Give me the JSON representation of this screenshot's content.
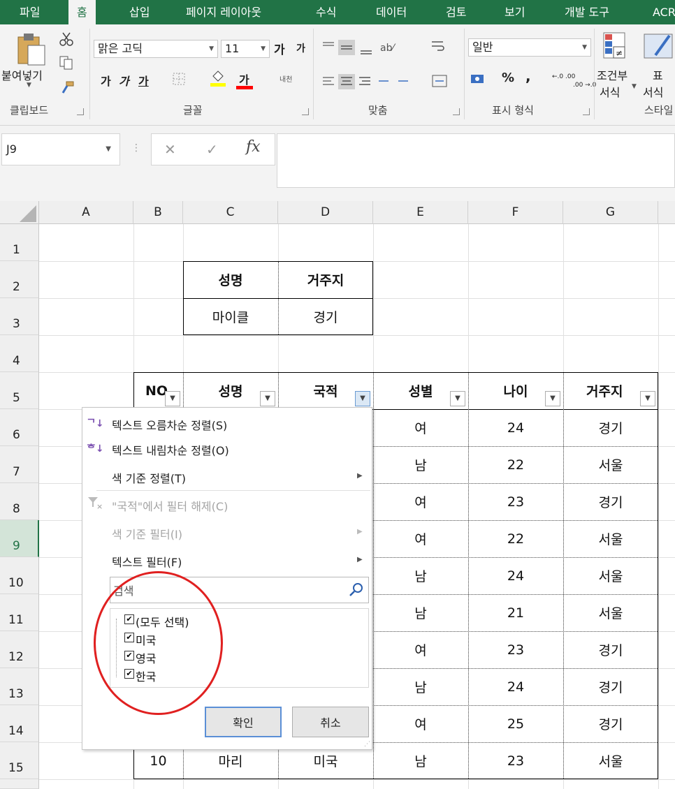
{
  "ribbon_tabs": [
    "파일",
    "홈",
    "삽입",
    "페이지 레이아웃",
    "수식",
    "데이터",
    "검토",
    "보기",
    "개발 도구",
    "ACR"
  ],
  "active_tab": "홈",
  "clipboard": {
    "paste_label": "붙여넣기",
    "group_label": "클립보드"
  },
  "font": {
    "name": "맑은 고딕",
    "size": "11",
    "grow": "가",
    "shrink": "가",
    "bold": "가",
    "italic": "가",
    "underline": "가",
    "font_color": "가",
    "phonetic": "내천",
    "group_label": "글꼴",
    "highlight_color": "#ffff00",
    "font_color_bar": "#ff0000"
  },
  "alignment": {
    "group_label": "맞춤"
  },
  "number": {
    "format": "일반",
    "percent": "%",
    "comma": ",",
    "inc_decimal": "←.0 .00",
    "dec_decimal": ".00 →.0",
    "group_label": "표시 형식"
  },
  "styles": {
    "conditional_line1": "조건부",
    "conditional_line2": "서식",
    "table_line1": "표",
    "table_line2": "서식",
    "group_label": "스타일"
  },
  "formula_bar": {
    "name_box": "J9",
    "cancel": "✕",
    "enter": "✓",
    "fx": "fx",
    "content": ""
  },
  "columns": [
    "A",
    "B",
    "C",
    "D",
    "E",
    "F",
    "G"
  ],
  "rows": [
    "1",
    "2",
    "3",
    "4",
    "5",
    "6",
    "7",
    "8",
    "9",
    "10",
    "11",
    "12",
    "13",
    "14",
    "15"
  ],
  "selected_row": "9",
  "small_table": {
    "headers": [
      "성명",
      "거주지"
    ],
    "row": [
      "마이클",
      "경기"
    ]
  },
  "main_table": {
    "headers": [
      "NO",
      "성명",
      "국적",
      "성별",
      "나이",
      "거주지"
    ],
    "rows": [
      [
        "여",
        "24",
        "경기"
      ],
      [
        "남",
        "22",
        "서울"
      ],
      [
        "여",
        "23",
        "경기"
      ],
      [
        "여",
        "22",
        "서울"
      ],
      [
        "남",
        "24",
        "서울"
      ],
      [
        "남",
        "21",
        "서울"
      ],
      [
        "여",
        "23",
        "경기"
      ],
      [
        "남",
        "24",
        "경기"
      ],
      [
        "여",
        "25",
        "경기"
      ]
    ],
    "last_row": [
      "10",
      "마리",
      "미국",
      "남",
      "23",
      "서울"
    ]
  },
  "filter_menu": {
    "sort_asc": "텍스트 오름차순 정렬(S)",
    "sort_desc": "텍스트 내림차순 정렬(O)",
    "sort_color": "색 기준 정렬(T)",
    "clear_filter": "\"국적\"에서 필터 해제(C)",
    "filter_color": "색 기준 필터(I)",
    "text_filter": "텍스트 필터(F)",
    "search_placeholder": "검색",
    "items": [
      "(모두 선택)",
      "미국",
      "영국",
      "한국"
    ],
    "ok": "확인",
    "cancel": "취소"
  },
  "annotation_color": "#e02020",
  "accent": "#217346"
}
